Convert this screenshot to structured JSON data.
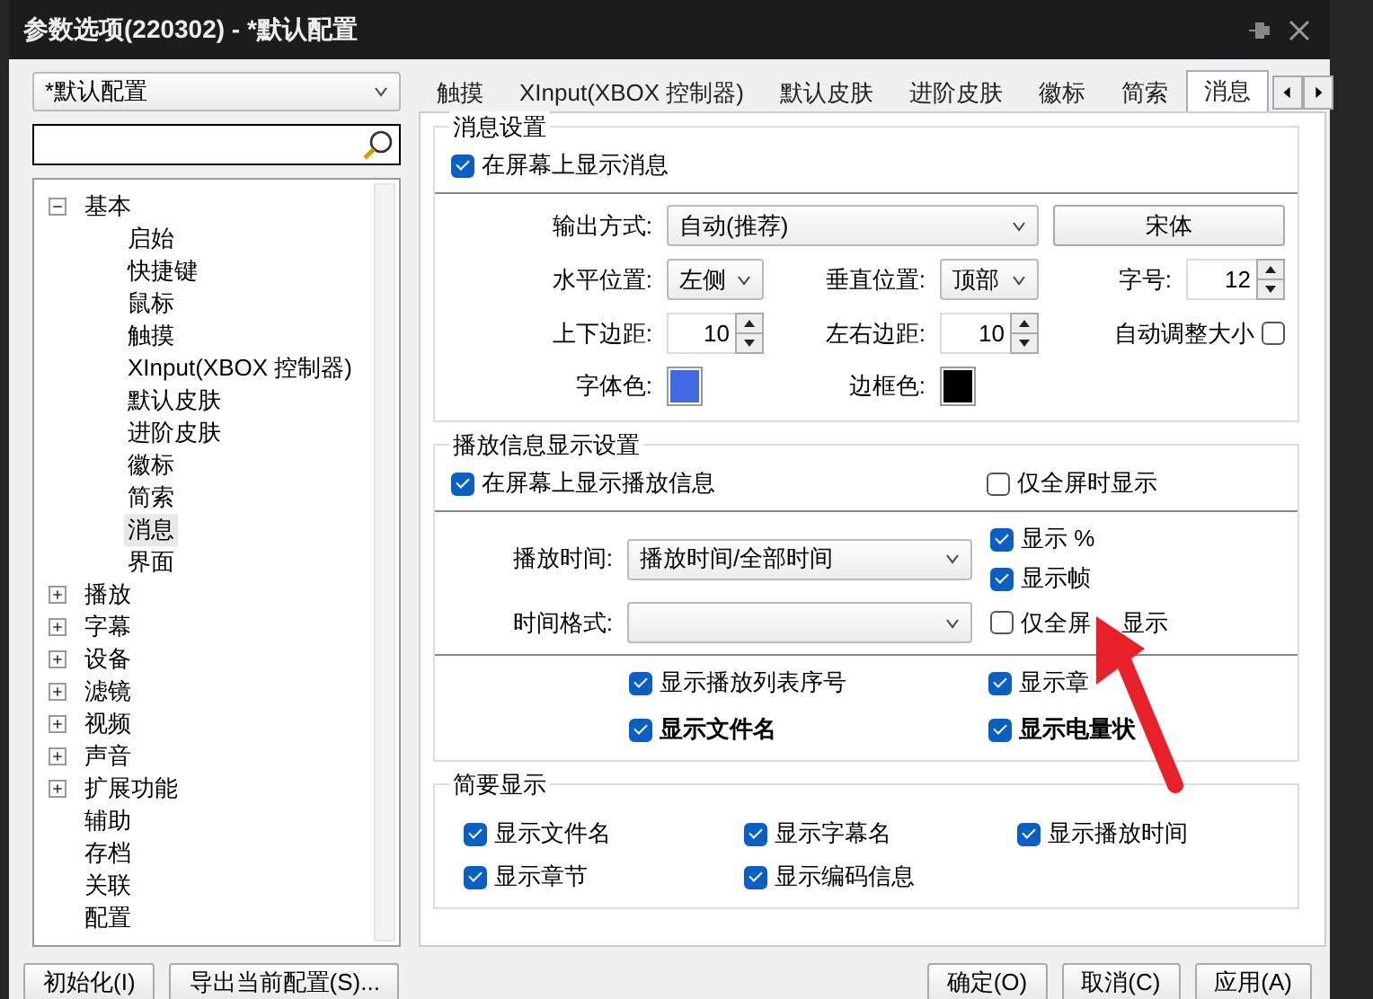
{
  "window": {
    "title": "参数选项(220302) - *默认配置"
  },
  "profile_select": {
    "value": "*默认配置"
  },
  "tree": [
    {
      "label": "基本",
      "expanded": true,
      "selected": false,
      "children": [
        {
          "label": "启始",
          "selected": false
        },
        {
          "label": "快捷键",
          "selected": false
        },
        {
          "label": "鼠标",
          "selected": false
        },
        {
          "label": "触摸",
          "selected": false
        },
        {
          "label": "XInput(XBOX 控制器)",
          "selected": false
        },
        {
          "label": "默认皮肤",
          "selected": false
        },
        {
          "label": "进阶皮肤",
          "selected": false
        },
        {
          "label": "徽标",
          "selected": false
        },
        {
          "label": "简索",
          "selected": false
        },
        {
          "label": "消息",
          "selected": true
        },
        {
          "label": "界面",
          "selected": false
        }
      ]
    },
    {
      "label": "播放",
      "expanded": false,
      "selected": false
    },
    {
      "label": "字幕",
      "expanded": false,
      "selected": false
    },
    {
      "label": "设备",
      "expanded": false,
      "selected": false
    },
    {
      "label": "滤镜",
      "expanded": false,
      "selected": false
    },
    {
      "label": "视频",
      "expanded": false,
      "selected": false
    },
    {
      "label": "声音",
      "expanded": false,
      "selected": false
    },
    {
      "label": "扩展功能",
      "expanded": false,
      "selected": false
    },
    {
      "label": "辅助",
      "selected": false
    },
    {
      "label": "存档",
      "selected": false
    },
    {
      "label": "关联",
      "selected": false
    },
    {
      "label": "配置",
      "selected": false
    }
  ],
  "tabs": [
    {
      "label": "触摸",
      "selected": false
    },
    {
      "label": "XInput(XBOX 控制器)",
      "selected": false
    },
    {
      "label": "默认皮肤",
      "selected": false
    },
    {
      "label": "进阶皮肤",
      "selected": false
    },
    {
      "label": "徽标",
      "selected": false
    },
    {
      "label": "简索",
      "selected": false
    },
    {
      "label": "消息",
      "selected": true
    }
  ],
  "message_settings": {
    "title": "消息设置",
    "show_on_screen": {
      "label": "在屏幕上显示消息",
      "checked": true
    },
    "output_mode": {
      "label": "输出方式:",
      "value": "自动(推荐)"
    },
    "font_button": "宋体",
    "horizontal_position": {
      "label": "水平位置:",
      "value": "左侧"
    },
    "vertical_position": {
      "label": "垂直位置:",
      "value": "顶部"
    },
    "font_size": {
      "label": "字号:",
      "value": "12"
    },
    "top_bottom_margin": {
      "label": "上下边距:",
      "value": "10"
    },
    "left_right_margin": {
      "label": "左右边距:",
      "value": "10"
    },
    "auto_resize": {
      "label": "自动调整大小",
      "checked": false
    },
    "font_color": {
      "label": "字体色:",
      "color": "#4169e1"
    },
    "border_color": {
      "label": "边框色:",
      "color": "#000000"
    }
  },
  "playback_info": {
    "title": "播放信息显示设置",
    "show_on_screen": {
      "label": "在屏幕上显示播放信息",
      "checked": true
    },
    "fullscreen_only": {
      "label": "仅全屏时显示",
      "checked": false
    },
    "play_time": {
      "label": "播放时间:",
      "value": "播放时间/全部时间"
    },
    "time_format": {
      "label": "时间格式:"
    },
    "show_percent": {
      "label": "显示 %",
      "checked": true
    },
    "show_frame": {
      "label": "显示帧",
      "checked": true
    },
    "time_fullscreen_only": {
      "label": "仅全屏",
      "label_tail": "显示",
      "checked": false
    },
    "options": [
      {
        "label": "显示播放列表序号",
        "checked": true,
        "bold": false
      },
      {
        "label": "显示章",
        "checked": true,
        "bold": false
      },
      {
        "label": "显示文件名",
        "checked": true,
        "bold": true
      },
      {
        "label": "显示电量状",
        "checked": true,
        "bold": true
      }
    ]
  },
  "brief_display": {
    "title": "简要显示",
    "items": [
      {
        "label": "显示文件名",
        "checked": true
      },
      {
        "label": "显示字幕名",
        "checked": true
      },
      {
        "label": "显示播放时间",
        "checked": true
      },
      {
        "label": "显示章节",
        "checked": true
      },
      {
        "label": "显示编码信息",
        "checked": true
      }
    ]
  },
  "buttons_left": [
    "初始化(I)",
    "导出当前配置(S)..."
  ],
  "buttons_right": [
    "确定(O)",
    "取消(C)",
    "应用(A)"
  ]
}
